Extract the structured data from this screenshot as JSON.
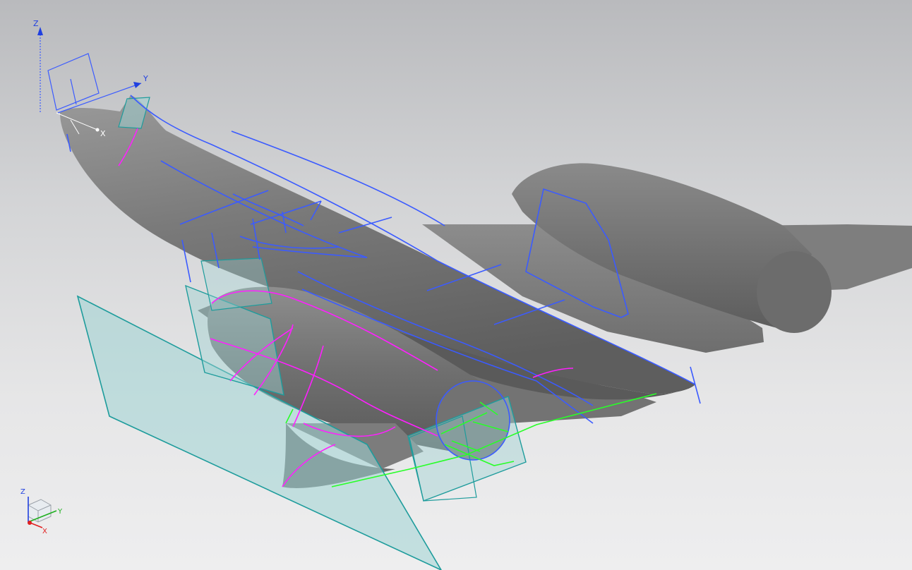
{
  "viewport": {
    "background_top": "#b9babd",
    "background_bottom": "#eeeeef"
  },
  "colors": {
    "body_surface": "#7d7d7d",
    "sketch_curve": "#3b5bff",
    "edge_curve": "#ff1fff",
    "bridge_curve": "#28ff28",
    "datum_plane_fill": "#9fd3d3",
    "datum_plane_edge": "#1e9c9c"
  },
  "datum_csys": {
    "x_label": "X",
    "y_label": "Y",
    "z_label": "Z"
  },
  "view_triad": {
    "x_label": "X",
    "y_label": "Y",
    "z_label": "Z",
    "x_color": "#e02020",
    "y_color": "#20b020",
    "z_color": "#2040e0"
  }
}
